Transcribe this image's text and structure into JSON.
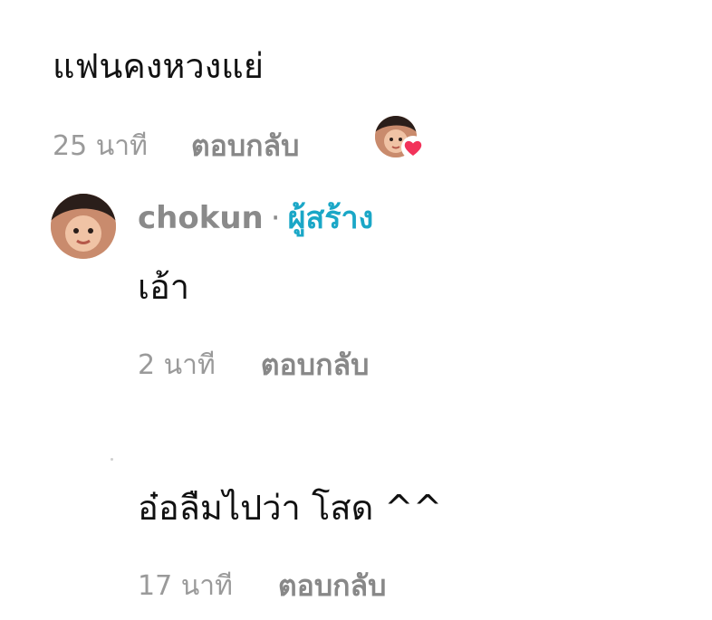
{
  "comments": [
    {
      "text": "แฟนคงหวงแย่",
      "time": "25 นาที",
      "reply_label": "ตอบกลับ",
      "liked_by_creator": true
    },
    {
      "author": "chokun",
      "separator": "·",
      "badge": "ผู้สร้าง",
      "text": "เอ้า",
      "time": "2 นาที",
      "reply_label": "ตอบกลับ"
    },
    {
      "text": "อ๋อลืมไปว่า โสด ^^",
      "time": "17 นาที",
      "reply_label": "ตอบกลับ"
    }
  ],
  "colors": {
    "creator_badge": "#1aa7c7",
    "heart": "#f2335a",
    "muted_text": "#9a9a9a"
  },
  "icons": {
    "liked_indicator": "heart-icon"
  }
}
